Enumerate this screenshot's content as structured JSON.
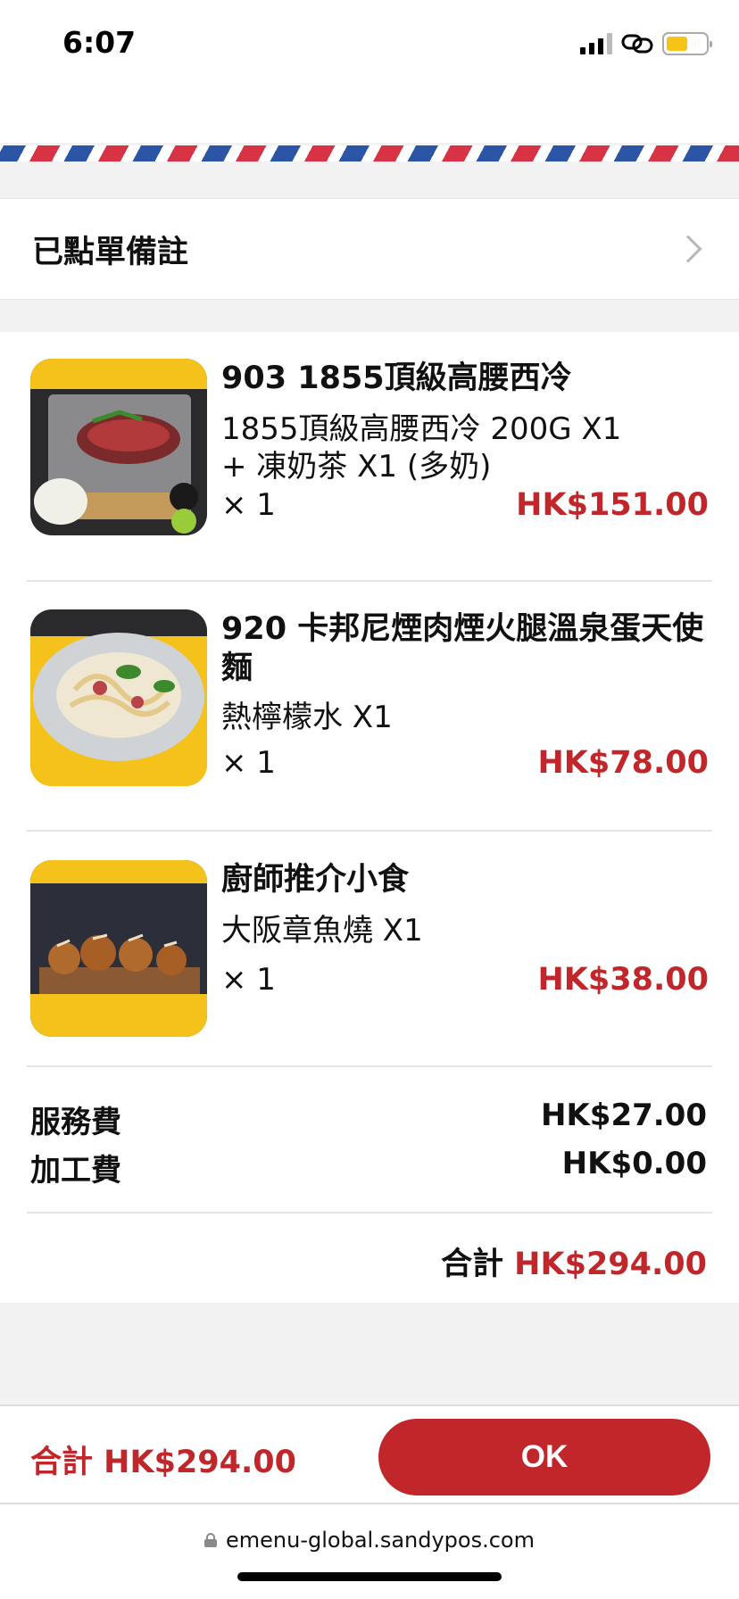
{
  "status": {
    "time": "6:07"
  },
  "remarks": {
    "label": "已點單備註"
  },
  "items": [
    {
      "name": "903 1855頂級高腰西冷",
      "desc": "1855頂級高腰西冷 200G X1\n+ 凍奶茶 X1 (多奶)",
      "qty": "× 1",
      "price": "HK$151.00",
      "image": "steak-on-stone-photo"
    },
    {
      "name": "920 卡邦尼煙肉煙火腿溫泉蛋天使麵",
      "desc": "熱檸檬水 X1",
      "qty": "× 1",
      "price": "HK$78.00",
      "image": "carbonara-pasta-photo"
    },
    {
      "name": "廚師推介小食",
      "desc": "大阪章魚燒 X1",
      "qty": "× 1",
      "price": "HK$38.00",
      "image": "takoyaki-photo"
    }
  ],
  "fees": {
    "service_label": "服務費",
    "service_value": "HK$27.00",
    "processing_label": "加工費",
    "processing_value": "HK$0.00"
  },
  "total": {
    "label": "合計",
    "value": "HK$294.00"
  },
  "bottom": {
    "total_text": "合計 HK$294.00",
    "ok_label": "OK"
  },
  "browser": {
    "url": "emenu-global.sandypos.com"
  },
  "colors": {
    "accent": "#c1262b",
    "airmail_red": "#d83245",
    "airmail_blue": "#2c55a6"
  }
}
